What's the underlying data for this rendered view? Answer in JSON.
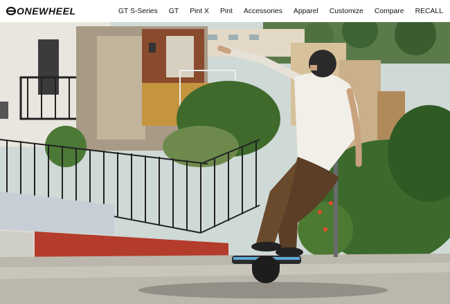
{
  "brand": {
    "logo_text": "ONEWHEEL"
  },
  "nav": {
    "items": [
      {
        "label": "GT S-Series"
      },
      {
        "label": "GT"
      },
      {
        "label": "Pint X"
      },
      {
        "label": "Pint"
      },
      {
        "label": "Accessories"
      },
      {
        "label": "Apparel"
      },
      {
        "label": "Customize"
      },
      {
        "label": "Compare"
      },
      {
        "label": "RECALL"
      }
    ]
  },
  "hero": {
    "image": "rider-on-onewheel-downhill-street",
    "colors": {
      "sky": "#c9d7dc",
      "street": "#b9b4a9",
      "foliage": "#3e6b2f",
      "curb_red": "#b23a2a"
    }
  }
}
